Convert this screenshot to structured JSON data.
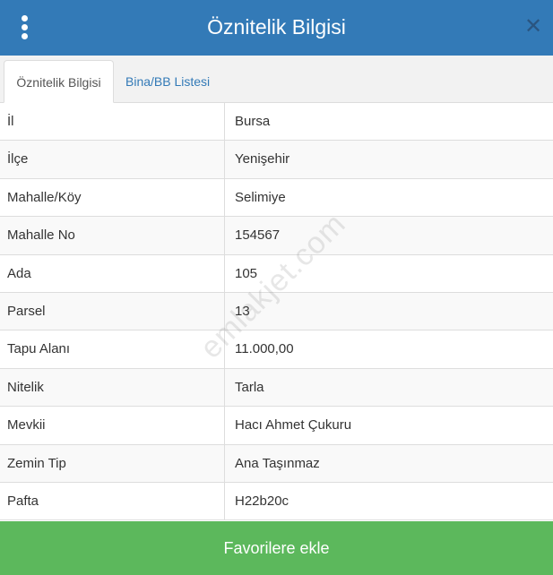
{
  "header": {
    "title": "Öznitelik Bilgisi"
  },
  "tabs": [
    {
      "label": "Öznitelik Bilgisi",
      "active": true
    },
    {
      "label": "Bina/BB Listesi",
      "active": false
    }
  ],
  "rows": [
    {
      "key": "İl",
      "value": "Bursa"
    },
    {
      "key": "İlçe",
      "value": "Yenişehir"
    },
    {
      "key": "Mahalle/Köy",
      "value": "Selimiye"
    },
    {
      "key": "Mahalle No",
      "value": "154567"
    },
    {
      "key": "Ada",
      "value": "105"
    },
    {
      "key": "Parsel",
      "value": "13"
    },
    {
      "key": "Tapu Alanı",
      "value": "11.000,00"
    },
    {
      "key": "Nitelik",
      "value": "Tarla"
    },
    {
      "key": "Mevkii",
      "value": "Hacı Ahmet Çukuru"
    },
    {
      "key": "Zemin Tip",
      "value": "Ana Taşınmaz"
    },
    {
      "key": "Pafta",
      "value": "H22b20c"
    }
  ],
  "watermark": "emlakjet.com",
  "footer": {
    "button_label": "Favorilere ekle"
  },
  "colors": {
    "header": "#337ab7",
    "button": "#5cb85c"
  },
  "icons": {
    "menu": "kebab-menu-icon",
    "close": "close-icon"
  }
}
